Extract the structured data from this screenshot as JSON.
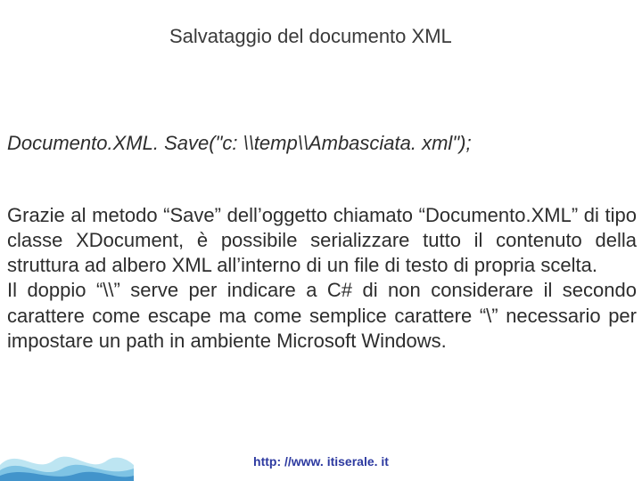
{
  "title": "Salvataggio del documento XML",
  "codeLine": "Documento.XML. Save(\"c: \\\\temp\\\\Ambasciata. xml\");",
  "body": "Grazie al metodo “Save” dell’oggetto chiamato “Documento.XML” di tipo classe XDocument, è possibile serializzare tutto il contenuto della struttura ad albero XML all’interno di un file di testo di propria scelta.\nIl doppio “\\\\” serve per indicare a C# di non considerare il secondo carattere come escape ma come semplice carattere “\\” necessario per impostare un path in ambiente Microsoft Windows.",
  "footerUrl": "http: //www. itiserale. it"
}
